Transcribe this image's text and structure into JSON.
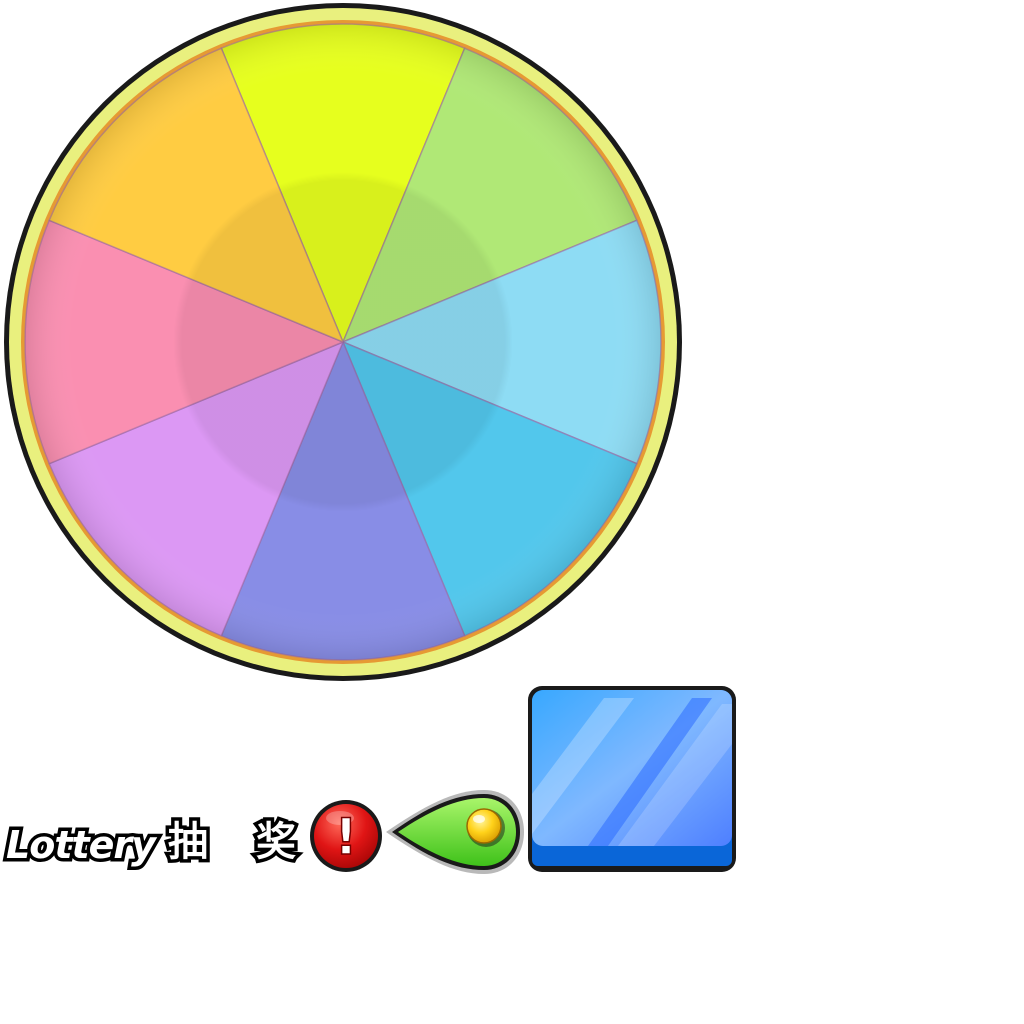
{
  "title": {
    "english": "Lottery",
    "chinese_1": "抽",
    "chinese_2": "奖"
  },
  "alert_badge": {
    "symbol": "!"
  },
  "icons": {
    "alert": "exclamation-icon",
    "pointer": "wheel-pointer-icon",
    "button": "glossy-blue-button"
  },
  "wheel": {
    "segment_count": 8,
    "segments": [
      {
        "name": "yellow",
        "color": "#E6FF1E"
      },
      {
        "name": "green",
        "color": "#B0E876"
      },
      {
        "name": "light-blue",
        "color": "#8EDCF4"
      },
      {
        "name": "cyan",
        "color": "#52C7EC"
      },
      {
        "name": "indigo",
        "color": "#888DE6"
      },
      {
        "name": "violet",
        "color": "#DC98F4"
      },
      {
        "name": "pink",
        "color": "#FA8FB1"
      },
      {
        "name": "orange",
        "color": "#FFCC42"
      }
    ],
    "rim_color": "#E9F07E",
    "rim_inner_color": "#E69A33",
    "outline_color": "#1A1A1A"
  },
  "colors": {
    "badge_red": "#E01515",
    "pointer_green": "#6DE43A",
    "pointer_knob": "#FFD21A",
    "button_blue": "#4FA8FF",
    "button_dark_blue": "#0A66D8"
  }
}
